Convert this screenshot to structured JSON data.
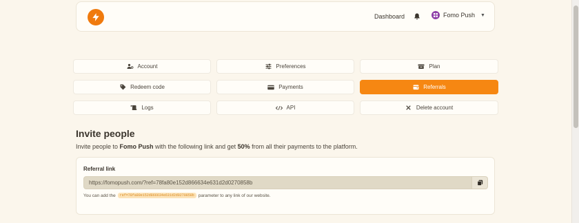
{
  "header": {
    "nav": {
      "dashboard": "Dashboard"
    },
    "user": {
      "name": "Fomo Push"
    },
    "icons": {
      "logo": "bolt-icon",
      "notifications": "bell-icon",
      "avatar": "grid-avatar-icon",
      "caret": "caret-down-icon"
    }
  },
  "menu": [
    {
      "label": "Account",
      "icon": "user-cog-icon",
      "active": false
    },
    {
      "label": "Preferences",
      "icon": "sliders-icon",
      "active": false
    },
    {
      "label": "Plan",
      "icon": "box-icon",
      "active": false
    },
    {
      "label": "Redeem code",
      "icon": "tag-icon",
      "active": false
    },
    {
      "label": "Payments",
      "icon": "credit-card-icon",
      "active": false
    },
    {
      "label": "Referrals",
      "icon": "wallet-icon",
      "active": true
    },
    {
      "label": "Logs",
      "icon": "scroll-icon",
      "active": false
    },
    {
      "label": "API",
      "icon": "code-icon",
      "active": false
    },
    {
      "label": "Delete account",
      "icon": "times-icon",
      "active": false
    }
  ],
  "invite": {
    "title": "Invite people",
    "desc_pre": "Invite people to ",
    "desc_brand": "Fomo Push",
    "desc_mid": " with the following link and get ",
    "desc_percent": "50%",
    "desc_post": " from all their payments to the platform."
  },
  "referral": {
    "label": "Referral link",
    "value": "https://fomopush.com/?ref=78fa80e152d866634e631d2d0270858b",
    "hint_pre": "You can add the",
    "param": "ref=78fa80e152d866634e631d2d0270858b",
    "hint_post": "parameter to any link of our website.",
    "copy_icon": "copy-icon"
  },
  "colors": {
    "accent": "#f68712",
    "background": "#fbf6ec",
    "avatar": "#8e3fa8"
  }
}
